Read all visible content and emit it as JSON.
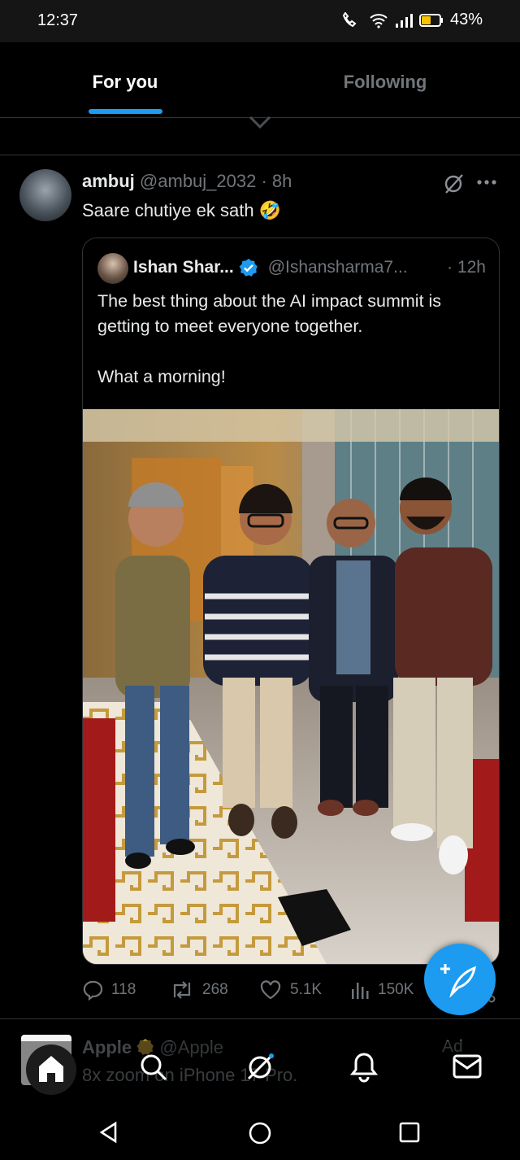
{
  "status_bar": {
    "time": "12:37",
    "battery": "43%"
  },
  "tabs": [
    {
      "label": "For you",
      "active": true
    },
    {
      "label": "Following",
      "active": false
    }
  ],
  "tweet": {
    "name": "ambuj",
    "handle": "@ambuj_2032",
    "time": "· 8h",
    "text": "Saare chutiye ek sath",
    "emoji": "🤣",
    "quote": {
      "name": "Ishan Shar...",
      "handle": "@Ishansharma7...",
      "time": "· 12h",
      "lines": [
        "The best thing about the AI impact summit is",
        "getting to meet everyone together.",
        "What a morning!"
      ]
    },
    "stats": {
      "replies": "118",
      "retweets": "268",
      "likes": "5.1K",
      "views": "150K"
    }
  },
  "next_tweet": {
    "name": "Apple",
    "handle": "@Apple",
    "text": "8x zoom on iPhone 17 Pro.",
    "ad_label": "Ad"
  },
  "colors": {
    "accent": "#1d9bf0",
    "text": "#e7e9ea",
    "muted": "#71767b",
    "divider": "#2f3336"
  }
}
